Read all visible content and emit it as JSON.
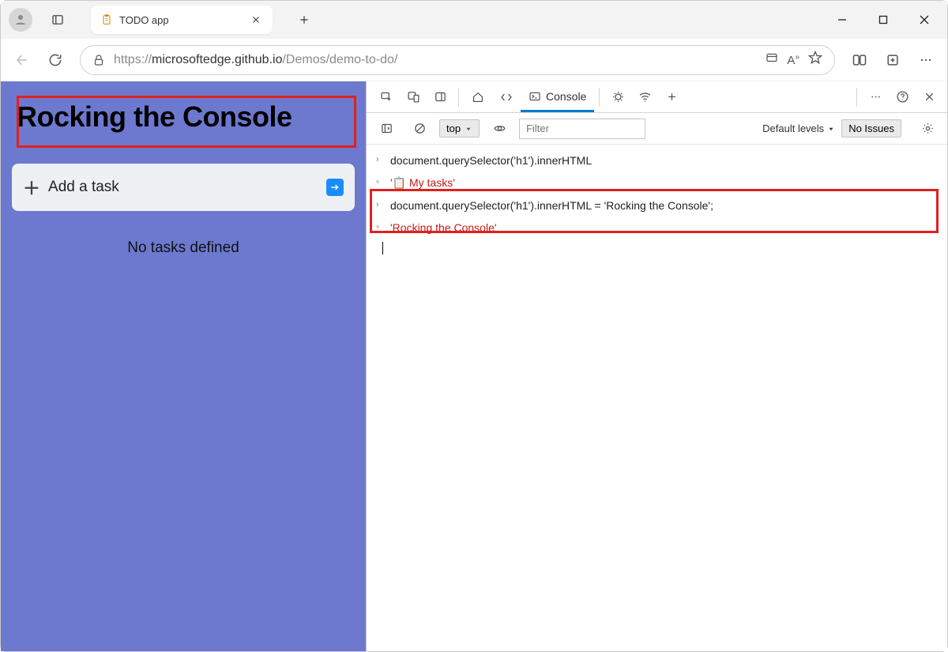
{
  "titlebar": {
    "tab_title": "TODO app"
  },
  "toolbar": {
    "url_prefix": "https://",
    "url_host": "microsoftedge.github.io",
    "url_path": "/Demos/demo-to-do/"
  },
  "page": {
    "heading": "Rocking the Console",
    "add_task_label": "Add a task",
    "empty_msg": "No tasks defined"
  },
  "devtools": {
    "tabs": {
      "console": "Console"
    },
    "console": {
      "context": "top",
      "filter_placeholder": "Filter",
      "levels": "Default levels",
      "issues": "No Issues",
      "log": {
        "line1": "document.querySelector('h1').innerHTML",
        "out1_pre": "'📋 ",
        "out1_text": "My tasks",
        "out1_post": "'",
        "line2": "document.querySelector('h1').innerHTML = 'Rocking the Console';",
        "out2": "'Rocking the Console'"
      }
    }
  }
}
